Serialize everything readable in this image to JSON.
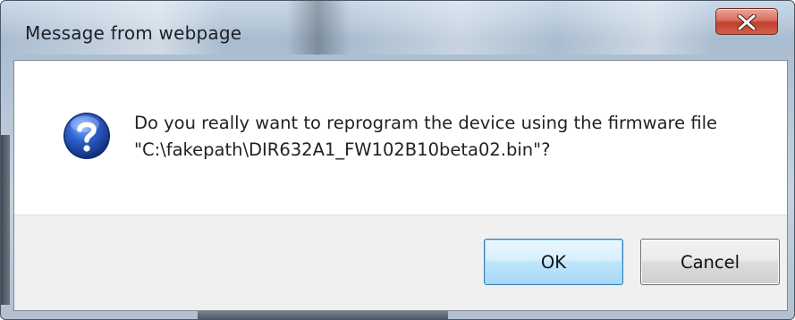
{
  "window": {
    "title": "Message from webpage",
    "close_icon": "close-x-icon"
  },
  "dialog": {
    "icon": "question-icon",
    "message": "Do you really want to reprogram the device using the firmware file \"C:\\fakepath\\DIR632A1_FW102B10beta02.bin\"?"
  },
  "buttons": {
    "ok_label": "OK",
    "cancel_label": "Cancel"
  },
  "colors": {
    "close_button": "#c7432f",
    "ok_border": "#3c7fb1",
    "icon_blue": "#2451b8"
  }
}
